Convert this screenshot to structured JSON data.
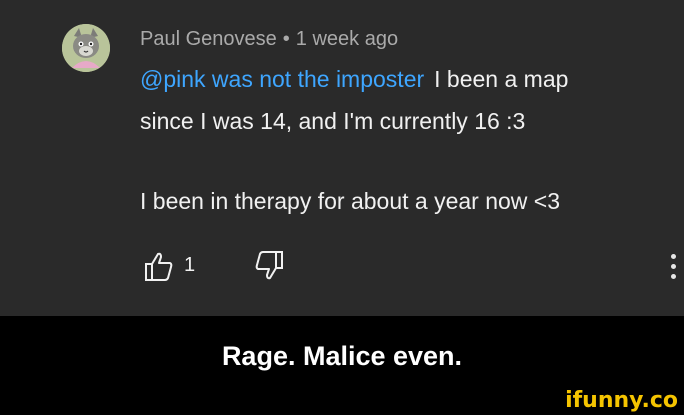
{
  "comment": {
    "author": "Paul Genovese",
    "separator": "•",
    "timestamp": "1 week ago",
    "mention": "@pink was not the imposter",
    "line1_rest": "I been a map",
    "line2": "since I was 14, and I'm currently 16 :3",
    "line3": "I been in therapy for about a year now <3",
    "like_count": "1",
    "icons": {
      "avatar": "cartoon-cat-avatar",
      "like": "thumbs-up-icon",
      "dislike": "thumbs-down-icon",
      "more": "kebab-menu-icon"
    }
  },
  "caption": "Rage. Malice even.",
  "watermark": "ifunny.co",
  "colors": {
    "background": "#2a2a2a",
    "mention": "#3ea6ff",
    "caption_bg": "#000000",
    "watermark": "#f5c400"
  }
}
